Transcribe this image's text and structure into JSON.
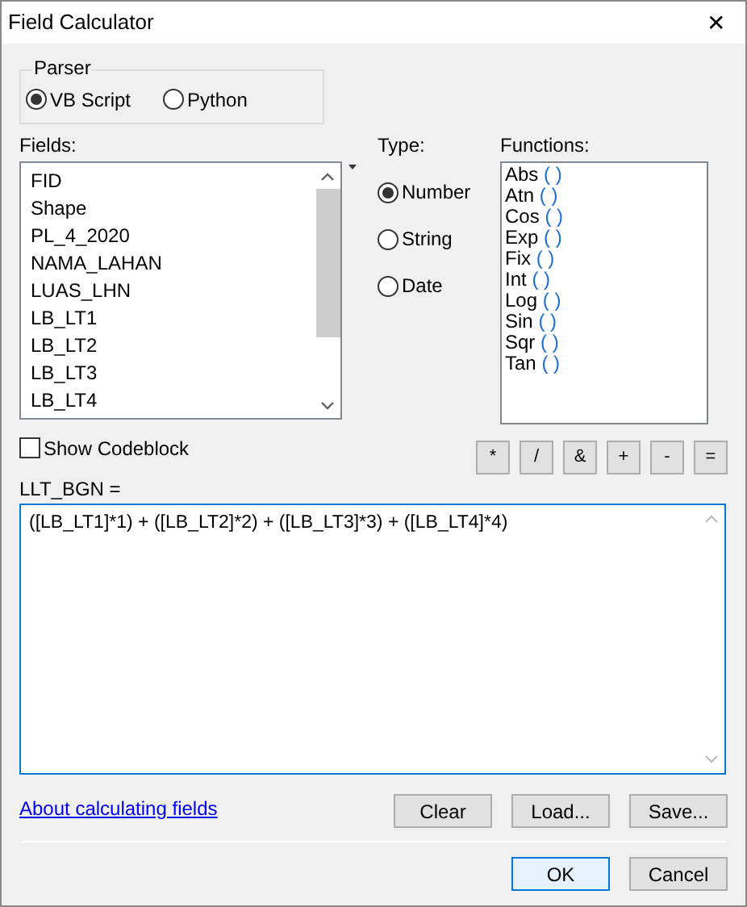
{
  "window": {
    "title": "Field Calculator",
    "close": "✕"
  },
  "parser": {
    "label": "Parser",
    "options": [
      {
        "label": "VB Script",
        "selected": true
      },
      {
        "label": "Python",
        "selected": false
      }
    ]
  },
  "fields": {
    "label": "Fields:",
    "items": [
      "FID",
      "Shape",
      "PL_4_2020",
      "NAMA_LAHAN",
      "LUAS_LHN",
      "LB_LT1",
      "LB_LT2",
      "LB_LT3",
      "LB_LT4"
    ]
  },
  "type": {
    "label": "Type:",
    "options": [
      {
        "label": "Number",
        "selected": true
      },
      {
        "label": "String",
        "selected": false
      },
      {
        "label": "Date",
        "selected": false
      }
    ]
  },
  "functions": {
    "label": "Functions:",
    "items": [
      {
        "name": "Abs",
        "args": "( )"
      },
      {
        "name": "Atn",
        "args": "( )"
      },
      {
        "name": "Cos",
        "args": "( )"
      },
      {
        "name": "Exp",
        "args": "( )"
      },
      {
        "name": "Fix",
        "args": "( )"
      },
      {
        "name": "Int",
        "args": "( )"
      },
      {
        "name": "Log",
        "args": "( )"
      },
      {
        "name": "Sin",
        "args": "( )"
      },
      {
        "name": "Sqr",
        "args": "( )"
      },
      {
        "name": "Tan",
        "args": "( )"
      }
    ]
  },
  "show_codeblock": {
    "label": "Show Codeblock",
    "checked": false
  },
  "operators": [
    "*",
    "/",
    "&",
    "+",
    "-",
    "="
  ],
  "expression": {
    "label": "LLT_BGN =",
    "value": "([LB_LT1]*1) + ([LB_LT2]*2) + ([LB_LT3]*3) + ([LB_LT4]*4)"
  },
  "help_link": "About calculating fields",
  "buttons": [
    "Clear",
    "Load...",
    "Save..."
  ],
  "footer_buttons": [
    {
      "label": "OK",
      "default": true
    },
    {
      "label": "Cancel",
      "default": false
    }
  ]
}
